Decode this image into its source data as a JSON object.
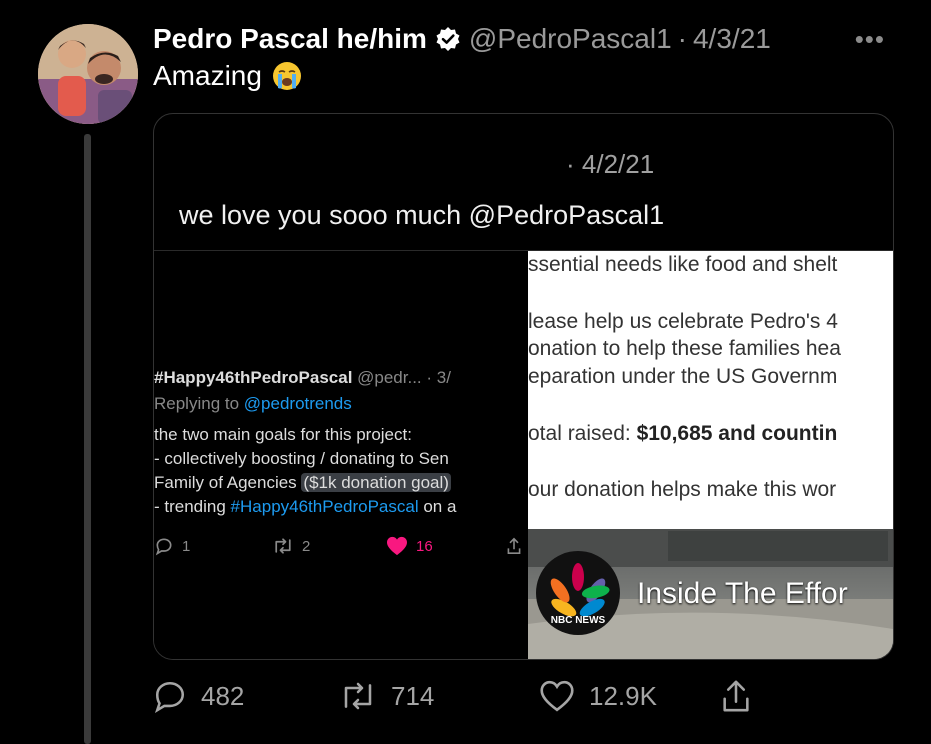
{
  "tweet": {
    "author_name": "Pedro Pascal he/him",
    "handle": "@PedroPascal1",
    "separator": "·",
    "date": "4/3/21",
    "more_label": "•••",
    "text": "Amazing",
    "emoji": "loudly-crying-face"
  },
  "quoted": {
    "date": "· 4/2/21",
    "text": "we love you sooo much @PedroPascal1",
    "screenshot": {
      "left_tweet": {
        "display_name": "#Happy46thPedroPascal",
        "meta": " @pedr... · 3/",
        "replying_prefix": "Replying to ",
        "replying_mention": "@pedrotrends",
        "line1": "the two main goals for this project:",
        "line2": "- collectively boosting / donating to Sen",
        "line3_a": "Family of Agencies ",
        "line3_hl": "($1k donation goal)",
        "line4_a": "- trending ",
        "line4_tag": "#Happy46thPedroPascal",
        "line4_b": " on a",
        "reply_count": "1",
        "retweet_count": "2",
        "like_count": "16"
      },
      "donation": {
        "line1": "ssential needs like food and shelt",
        "line2": "lease help us celebrate Pedro's 4",
        "line3": "onation to help these families hea",
        "line4": "eparation under the US Governm",
        "line5_a": "otal raised: ",
        "line5_b": "$10,685 and countin",
        "line6": "our donation helps make this wor"
      },
      "video": {
        "logo_text": "NBC NEWS",
        "caption": "Inside The Effor"
      }
    }
  },
  "actions": {
    "replies": "482",
    "retweets": "714",
    "likes": "12.9K"
  },
  "colors": {
    "accent": "#1d9bf0",
    "like": "#f91880",
    "background": "#000000"
  }
}
